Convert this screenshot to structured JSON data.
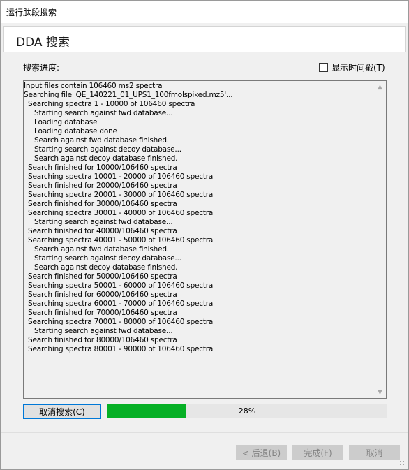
{
  "window": {
    "title": "运行肽段搜索"
  },
  "header": {
    "title": "DDA 搜索"
  },
  "progress_section": {
    "label": "搜索进度:",
    "timestamp_checkbox": {
      "label": "显示时间戳(T)",
      "checked": false
    }
  },
  "log": {
    "lines": [
      {
        "indent": 0,
        "text": "Input files contain 106460 ms2 spectra"
      },
      {
        "indent": 0,
        "text": "Searching file 'QE_140221_01_UPS1_100fmolspiked.mz5'..."
      },
      {
        "indent": 1,
        "text": "Searching spectra 1 - 10000 of 106460 spectra"
      },
      {
        "indent": 2,
        "text": "Starting search against fwd database..."
      },
      {
        "indent": 2,
        "text": "Loading database"
      },
      {
        "indent": 2,
        "text": "Loading database done"
      },
      {
        "indent": 2,
        "text": "Search against fwd database finished."
      },
      {
        "indent": 2,
        "text": "Starting search against decoy database..."
      },
      {
        "indent": 2,
        "text": "Search against decoy database finished."
      },
      {
        "indent": 1,
        "text": "Search finished for 10000/106460 spectra"
      },
      {
        "indent": 1,
        "text": "Searching spectra 10001 - 20000 of 106460 spectra"
      },
      {
        "indent": 1,
        "text": "Search finished for 20000/106460 spectra"
      },
      {
        "indent": 1,
        "text": "Searching spectra 20001 - 30000 of 106460 spectra"
      },
      {
        "indent": 1,
        "text": "Search finished for 30000/106460 spectra"
      },
      {
        "indent": 1,
        "text": "Searching spectra 30001 - 40000 of 106460 spectra"
      },
      {
        "indent": 2,
        "text": "Starting search against fwd database..."
      },
      {
        "indent": 1,
        "text": "Search finished for 40000/106460 spectra"
      },
      {
        "indent": 1,
        "text": "Searching spectra 40001 - 50000 of 106460 spectra"
      },
      {
        "indent": 2,
        "text": "Search against fwd database finished."
      },
      {
        "indent": 2,
        "text": "Starting search against decoy database..."
      },
      {
        "indent": 2,
        "text": "Search against decoy database finished."
      },
      {
        "indent": 1,
        "text": "Search finished for 50000/106460 spectra"
      },
      {
        "indent": 1,
        "text": "Searching spectra 50001 - 60000 of 106460 spectra"
      },
      {
        "indent": 1,
        "text": "Search finished for 60000/106460 spectra"
      },
      {
        "indent": 1,
        "text": "Searching spectra 60001 - 70000 of 106460 spectra"
      },
      {
        "indent": 1,
        "text": "Search finished for 70000/106460 spectra"
      },
      {
        "indent": 1,
        "text": "Searching spectra 70001 - 80000 of 106460 spectra"
      },
      {
        "indent": 2,
        "text": "Starting search against fwd database..."
      },
      {
        "indent": 1,
        "text": "Search finished for 80000/106460 spectra"
      },
      {
        "indent": 1,
        "text": "Searching spectra 80001 - 90000 of 106460 spectra"
      }
    ]
  },
  "controls": {
    "cancel_search_label": "取消搜索(C)",
    "progress_percent": 28,
    "progress_text": "28%",
    "progress_color": "#06b025"
  },
  "footer": {
    "back_label": "< 后退(B)",
    "finish_label": "完成(F)",
    "cancel_label": "取消"
  },
  "icons": {
    "scroll_up": "chevron-up-icon",
    "scroll_down": "chevron-down-icon",
    "resize": "resize-grip-icon"
  }
}
